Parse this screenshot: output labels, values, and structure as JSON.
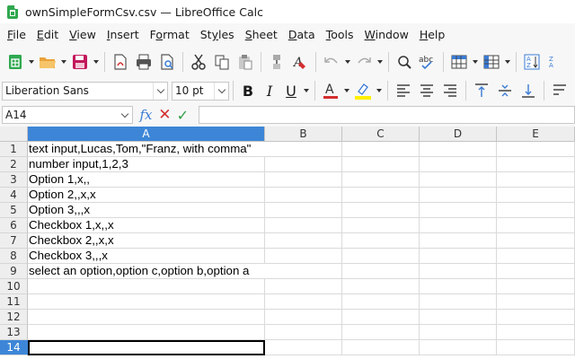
{
  "window": {
    "title": "ownSimpleFormCsv.csv — LibreOffice Calc"
  },
  "menu": [
    {
      "pre": "",
      "u": "F",
      "post": "ile"
    },
    {
      "pre": "",
      "u": "E",
      "post": "dit"
    },
    {
      "pre": "",
      "u": "V",
      "post": "iew"
    },
    {
      "pre": "",
      "u": "I",
      "post": "nsert"
    },
    {
      "pre": "F",
      "u": "o",
      "post": "rmat"
    },
    {
      "pre": "St",
      "u": "y",
      "post": "les"
    },
    {
      "pre": "",
      "u": "S",
      "post": "heet"
    },
    {
      "pre": "",
      "u": "D",
      "post": "ata"
    },
    {
      "pre": "",
      "u": "T",
      "post": "ools"
    },
    {
      "pre": "",
      "u": "W",
      "post": "indow"
    },
    {
      "pre": "",
      "u": "H",
      "post": "elp"
    }
  ],
  "formatting": {
    "font_name": "Liberation Sans",
    "font_size": "10 pt",
    "bold": "B",
    "italic": "I",
    "underline": "U"
  },
  "formula_bar": {
    "name_box": "A14",
    "fx": "fx",
    "cancel": "✕",
    "accept": "✓",
    "content": ""
  },
  "sheet": {
    "columns": [
      "A",
      "B",
      "C",
      "D",
      "E"
    ],
    "active_column": "A",
    "active_row": 14,
    "rows": [
      {
        "num": "1",
        "a": "text input,Lucas,Tom,\"Franz, with comma\""
      },
      {
        "num": "2",
        "a": "number input,1,2,3"
      },
      {
        "num": "3",
        "a": "Option 1,x,,"
      },
      {
        "num": "4",
        "a": "Option 2,,x,x"
      },
      {
        "num": "5",
        "a": "Option 3,,,x"
      },
      {
        "num": "6",
        "a": "Checkbox 1,x,,x"
      },
      {
        "num": "7",
        "a": "Checkbox 2,,x,x"
      },
      {
        "num": "8",
        "a": "Checkbox 3,,,x"
      },
      {
        "num": "9",
        "a": "select an option,option c,option b,option a"
      },
      {
        "num": "10",
        "a": ""
      },
      {
        "num": "11",
        "a": ""
      },
      {
        "num": "12",
        "a": ""
      },
      {
        "num": "13",
        "a": ""
      },
      {
        "num": "14",
        "a": ""
      }
    ]
  },
  "colors": {
    "accent": "#3d86d7",
    "calc_green": "#2fa84f"
  }
}
